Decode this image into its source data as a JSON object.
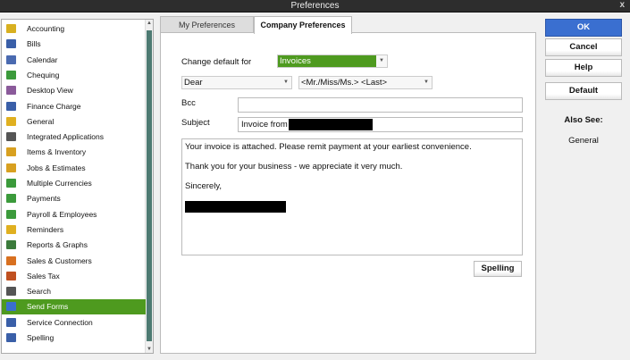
{
  "window": {
    "title": "Preferences",
    "close": "x"
  },
  "sidebar": {
    "items": [
      {
        "label": "Accounting",
        "color": "#d8b020"
      },
      {
        "label": "Bills",
        "color": "#3a5fa8"
      },
      {
        "label": "Calendar",
        "color": "#4a6ab0"
      },
      {
        "label": "Chequing",
        "color": "#3b9a3b"
      },
      {
        "label": "Desktop View",
        "color": "#8a5a9a"
      },
      {
        "label": "Finance Charge",
        "color": "#3a5fa8"
      },
      {
        "label": "General",
        "color": "#e0b020"
      },
      {
        "label": "Integrated Applications",
        "color": "#555555"
      },
      {
        "label": "Items & Inventory",
        "color": "#d8a020"
      },
      {
        "label": "Jobs & Estimates",
        "color": "#d8a020"
      },
      {
        "label": "Multiple Currencies",
        "color": "#3b9a3b"
      },
      {
        "label": "Payments",
        "color": "#3b9a3b"
      },
      {
        "label": "Payroll & Employees",
        "color": "#3b9a3b"
      },
      {
        "label": "Reminders",
        "color": "#e0b020"
      },
      {
        "label": "Reports & Graphs",
        "color": "#3b7a3b"
      },
      {
        "label": "Sales & Customers",
        "color": "#d87020"
      },
      {
        "label": "Sales Tax",
        "color": "#c05020"
      },
      {
        "label": "Search",
        "color": "#555555"
      },
      {
        "label": "Send Forms",
        "color": "#3a6fd0"
      },
      {
        "label": "Service Connection",
        "color": "#3a5fa8"
      },
      {
        "label": "Spelling",
        "color": "#3a5fa8"
      }
    ],
    "selected": "Send Forms"
  },
  "tabs": {
    "my": "My Preferences",
    "company": "Company Preferences"
  },
  "form": {
    "change_default_label": "Change default for",
    "change_default_value": "Invoices",
    "salutation": "Dear",
    "name_format": "<Mr./Miss/Ms.> <Last>",
    "bcc_label": "Bcc",
    "bcc_value": "",
    "subject_label": "Subject",
    "subject_value": "Invoice from",
    "body": [
      "Your invoice is attached.  Please remit payment at your earliest convenience.",
      "Thank you for your business - we appreciate it very much.",
      "Sincerely,"
    ],
    "spelling_button": "Spelling"
  },
  "buttons": {
    "ok": "OK",
    "cancel": "Cancel",
    "help": "Help",
    "default": "Default"
  },
  "also_see": {
    "title": "Also See:",
    "link": "General"
  }
}
